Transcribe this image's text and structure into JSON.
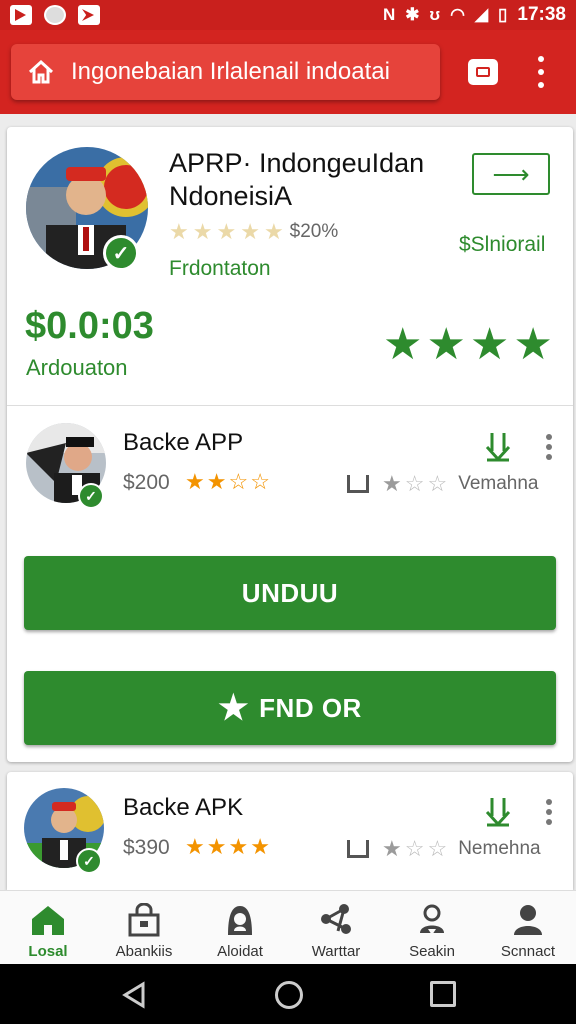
{
  "status_bar": {
    "time": "17:38",
    "notification_icons": [
      "app-icon",
      "avatar-icon",
      "app-icon"
    ],
    "system_icons": [
      "nfc-icon",
      "bluetooth-icon",
      "vibrate-icon",
      "wifi-icon",
      "signal-icon",
      "battery-icon"
    ]
  },
  "header": {
    "search_text": "Ingonebaian Irlalenail indoatai",
    "accent": "#d32420"
  },
  "featured": {
    "title": "APRP· IndongeuIdan NdoneisiA",
    "rating_percent": "$20%",
    "subtitle": "Frdontaton",
    "link_label": "$Slniorail",
    "price": "$0.0:03",
    "price_caption": "Ardouaton",
    "big_stars": 4
  },
  "apps": [
    {
      "title": "Backe APP",
      "price": "$200",
      "stars": 2.5,
      "meta_stars": 1,
      "meta_label": "Vemahna"
    },
    {
      "title": "Backe APK",
      "price": "$390",
      "stars": 4,
      "meta_stars": 1,
      "meta_label": "Nemehna"
    }
  ],
  "buttons": {
    "primary_label": "UNDUU",
    "secondary_label": "FND OR"
  },
  "bottom_nav": [
    {
      "label": "Losal",
      "icon": "home-icon",
      "active": true
    },
    {
      "label": "Abankiis",
      "icon": "store-icon",
      "active": false
    },
    {
      "label": "Aloidat",
      "icon": "user-hat-icon",
      "active": false
    },
    {
      "label": "Warttar",
      "icon": "share-icon",
      "active": false
    },
    {
      "label": "Seakin",
      "icon": "person-pin-icon",
      "active": false
    },
    {
      "label": "Scnnact",
      "icon": "person-icon",
      "active": false
    }
  ],
  "colors": {
    "primary_green": "#2e8b2e",
    "header_red": "#d32420",
    "star_orange": "#f39300"
  }
}
